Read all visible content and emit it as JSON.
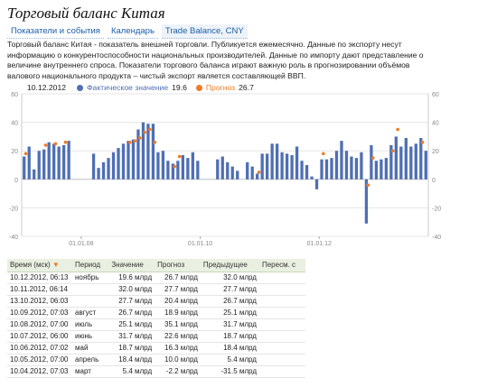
{
  "page": {
    "title": "Торговый баланс Китая",
    "tabs": [
      "Показатели и события",
      "Календарь",
      "Trade Balance, CNY"
    ],
    "description": "Торговый баланс Китая - показатель внешней торговли. Публикуется ежемесячно. Данные по экспорту несут информацию о конкурентоспособности национальных производителей. Данные по импорту дают представление о величине внутреннего спроса. Показатели торгового баланса играют важную роль в прогнозировании объёмов валового национального продукта – чистый экспорт является составляющей ВВП."
  },
  "legend": {
    "date": "10.12.2012",
    "actual_label": "Фактическое значение",
    "actual_value": "19.6",
    "forecast_label": "Прогноз",
    "forecast_value": "26.7"
  },
  "colors": {
    "actual": "#4f6fb3",
    "forecast": "#f07a24",
    "header": "#e9f0e1"
  },
  "chart_data": {
    "type": "bar",
    "ylim": [
      -40,
      60
    ],
    "yticks": [
      -40,
      -20,
      0,
      20,
      40,
      60
    ],
    "xtick_labels": [
      "01.01.08",
      "01.01.10",
      "01.01.12"
    ],
    "xtick_indices": [
      12,
      36,
      60
    ],
    "series": [
      {
        "values": [
          16,
          23,
          7,
          20,
          21,
          26,
          25,
          23,
          24,
          27,
          null,
          null,
          null,
          null,
          18,
          8,
          12,
          15,
          19,
          22,
          25,
          27,
          28,
          35,
          40,
          39,
          39,
          19,
          20,
          13,
          11,
          13,
          17,
          15,
          19,
          13,
          null,
          null,
          null,
          14,
          16,
          12,
          9,
          6,
          null,
          12,
          9,
          4,
          18,
          18,
          25,
          25,
          19,
          18,
          17,
          23,
          13,
          10,
          2,
          -7,
          14,
          14,
          15,
          20,
          27,
          20,
          16,
          15,
          19,
          -31,
          24,
          13,
          14,
          15,
          24,
          30,
          23,
          29,
          23,
          25,
          29,
          20
        ],
        "note": "actual values (billion USD), monthly, estimated from chart"
      },
      {
        "values": [
          18,
          null,
          null,
          null,
          24,
          null,
          25,
          null,
          26,
          null,
          null,
          null,
          null,
          null,
          null,
          null,
          null,
          null,
          null,
          null,
          null,
          26,
          27,
          29,
          33,
          35,
          26,
          null,
          null,
          null,
          9,
          16,
          null,
          null,
          null,
          null,
          null,
          null,
          null,
          null,
          null,
          null,
          null,
          null,
          null,
          null,
          null,
          5,
          null,
          null,
          null,
          null,
          null,
          null,
          null,
          null,
          null,
          null,
          null,
          null,
          18,
          null,
          null,
          null,
          null,
          null,
          null,
          null,
          null,
          -4,
          15,
          null,
          null,
          null,
          20,
          35,
          null,
          null,
          null,
          null,
          26,
          null
        ]
      }
    ]
  },
  "table": {
    "headers": [
      "Время (мск)",
      "Период",
      "Значение",
      "Прогноз",
      "Предыдущее",
      "Пересм. с"
    ],
    "sort_marker": "▼",
    "rows": [
      [
        "10.12.2012, 06:13",
        "ноябрь",
        "19.6 млрд",
        "26.7 млрд",
        "32.0 млрд",
        ""
      ],
      [
        "10.11.2012, 06:14",
        "",
        "32.0 млрд",
        "27.7 млрд",
        "27.7 млрд",
        ""
      ],
      [
        "13.10.2012, 06:03",
        "",
        "27.7 млрд",
        "20.4 млрд",
        "26.7 млрд",
        ""
      ],
      [
        "10.09.2012, 07:03",
        "август",
        "26.7 млрд",
        "18.9 млрд",
        "25.1 млрд",
        ""
      ],
      [
        "10.08.2012, 07:00",
        "июль",
        "25.1 млрд",
        "35.1 млрд",
        "31.7 млрд",
        ""
      ],
      [
        "10.07.2012, 06:00",
        "июнь",
        "31.7 млрд",
        "22.6 млрд",
        "18.7 млрд",
        ""
      ],
      [
        "10.06.2012, 07:02",
        "май",
        "18.7 млрд",
        "16.3 млрд",
        "18.4 млрд",
        ""
      ],
      [
        "10.05.2012, 07:00",
        "апрель",
        "18.4 млрд",
        "10.0 млрд",
        "5.4 млрд",
        ""
      ],
      [
        "10.04.2012, 07:03",
        "март",
        "5.4 млрд",
        "-2.2 млрд",
        "-31.5 млрд",
        ""
      ]
    ]
  }
}
